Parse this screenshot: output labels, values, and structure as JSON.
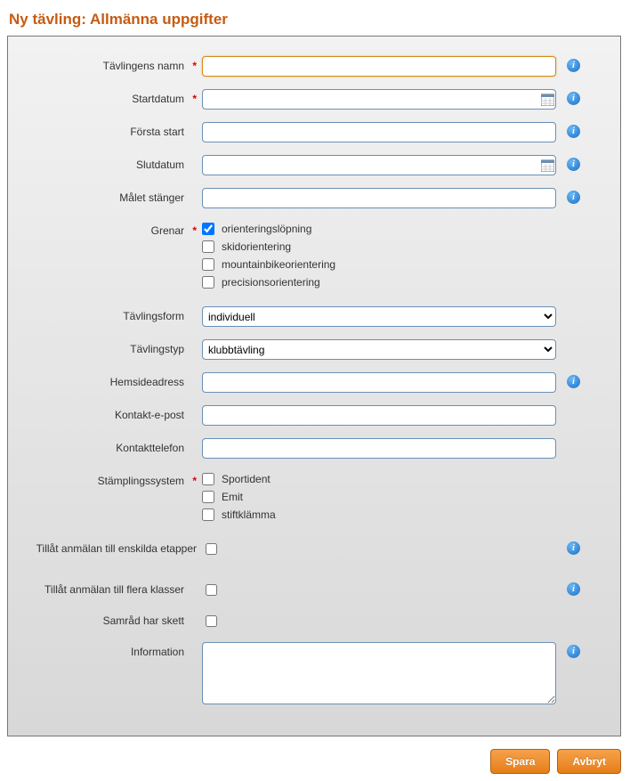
{
  "page": {
    "title": "Ny tävling: Allmänna uppgifter"
  },
  "labels": {
    "name": "Tävlingens namn",
    "startdate": "Startdatum",
    "firststart": "Första start",
    "enddate": "Slutdatum",
    "finishclose": "Målet stänger",
    "disciplines": "Grenar",
    "form": "Tävlingsform",
    "type": "Tävlingstyp",
    "homepage": "Hemsideadress",
    "email": "Kontakt-e-post",
    "phone": "Kontakttelefon",
    "punching": "Stämplingssystem",
    "allowstage": "Tillåt anmälan till enskilda etapper",
    "allowmulti": "Tillåt anmälan till flera klasser",
    "consult": "Samråd har skett",
    "info": "Information"
  },
  "values": {
    "name": "",
    "startdate": "",
    "firststart": "",
    "enddate": "",
    "finishclose": "",
    "form_selected": "individuell",
    "type_selected": "klubbtävling",
    "homepage": "",
    "email": "",
    "phone": "",
    "info": ""
  },
  "disciplines": [
    {
      "label": "orienteringslöpning",
      "checked": true
    },
    {
      "label": "skidorientering",
      "checked": false
    },
    {
      "label": "mountainbikeorientering",
      "checked": false
    },
    {
      "label": "precisionsorientering",
      "checked": false
    }
  ],
  "punching": [
    {
      "label": "Sportident",
      "checked": false
    },
    {
      "label": "Emit",
      "checked": false
    },
    {
      "label": "stiftklämma",
      "checked": false
    }
  ],
  "checks": {
    "allowstage": false,
    "allowmulti": false,
    "consult": false
  },
  "form_options": [
    "individuell"
  ],
  "type_options": [
    "klubbtävling"
  ],
  "buttons": {
    "save": "Spara",
    "cancel": "Avbryt"
  },
  "required_mark": "*",
  "info_glyph": "i"
}
